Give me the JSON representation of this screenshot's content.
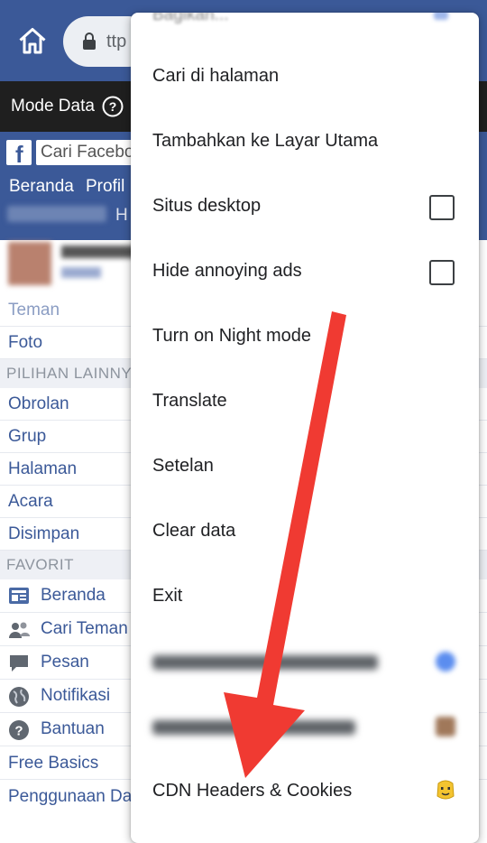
{
  "browser": {
    "url_text": "ttp",
    "data_bar_label": "Mode Data"
  },
  "facebook": {
    "search_placeholder": "Cari Facebo",
    "nav": [
      "Beranda",
      "Profil",
      "H"
    ],
    "menu_items": [
      "Teman",
      "Foto"
    ],
    "section_more": "PILIHAN LAINNY",
    "more_items": [
      "Obrolan",
      "Grup",
      "Halaman",
      "Acara",
      "Disimpan"
    ],
    "section_fav": "FAVORIT",
    "fav_items": [
      {
        "label": "Beranda",
        "icon": "news-feed-icon"
      },
      {
        "label": "Cari Teman",
        "icon": "friends-icon"
      },
      {
        "label": "Pesan",
        "icon": "message-icon"
      },
      {
        "label": "Notifikasi",
        "icon": "globe-icon"
      },
      {
        "label": "Bantuan",
        "icon": "help-icon"
      }
    ],
    "bottom_items": [
      "Free Basics",
      "Penggunaan Da"
    ]
  },
  "overflow_menu": {
    "partial_top": "Bagikan...",
    "items": [
      {
        "label": "Cari di halaman"
      },
      {
        "label": "Tambahkan ke Layar Utama"
      },
      {
        "label": "Situs desktop",
        "checked": false
      },
      {
        "label": "Hide annoying ads",
        "checked": false
      },
      {
        "label": "Turn on Night mode"
      },
      {
        "label": "Translate"
      },
      {
        "label": "Setelan"
      },
      {
        "label": "Clear data"
      },
      {
        "label": "Exit"
      },
      {
        "label": "CDN Headers & Cookies",
        "icon": "cookie-face-icon"
      }
    ]
  },
  "colors": {
    "facebook_blue": "#3b5998",
    "arrow_red": "#f03a32"
  }
}
